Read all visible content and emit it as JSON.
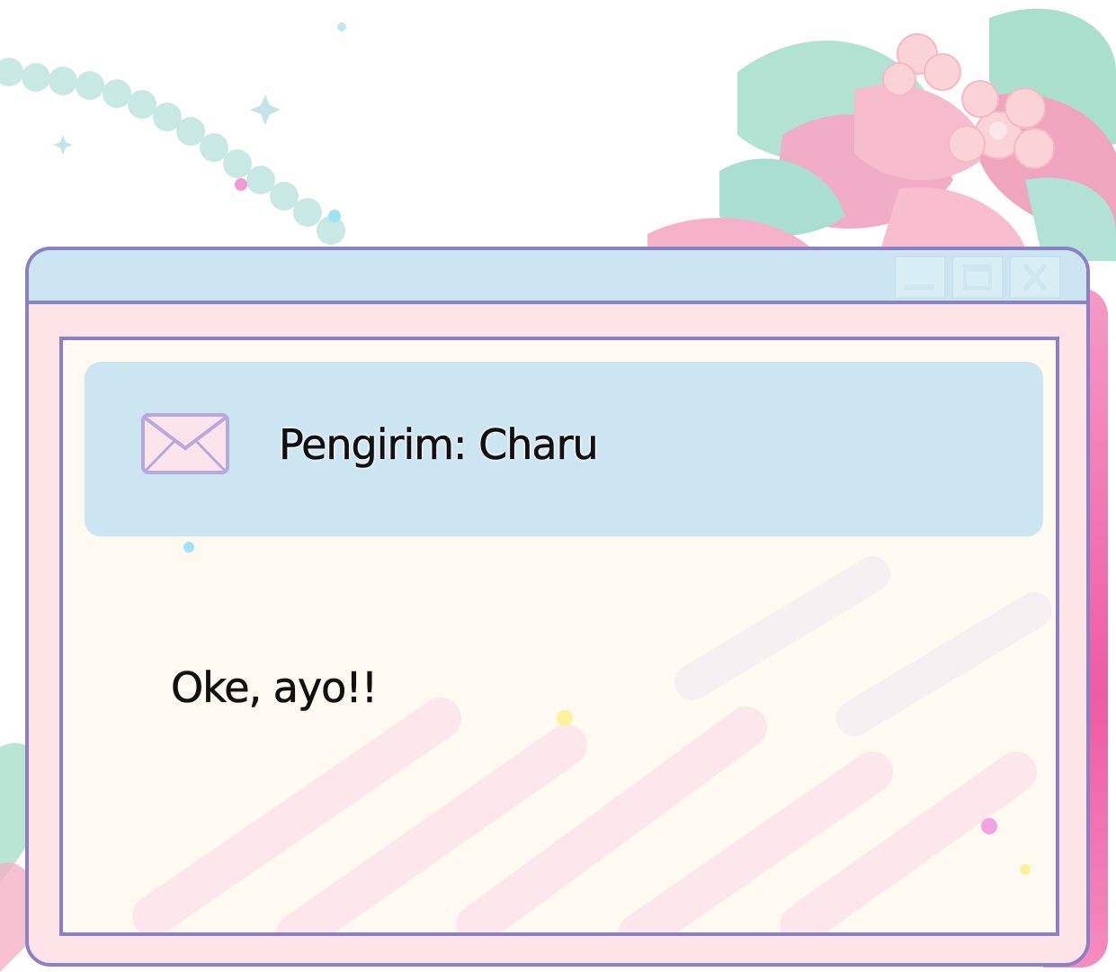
{
  "window": {
    "controls": {
      "minimize": "minimize-icon",
      "maximize": "maximize-icon",
      "close": "close-icon"
    }
  },
  "header": {
    "icon": "mail-icon",
    "sender_label": "Pengirim: Charu"
  },
  "message": {
    "text": "Oke, ayo!!"
  },
  "colors": {
    "frame_border": "#8a80c8",
    "titlebar": "#cbe6f1",
    "window_body": "#fbe3e6",
    "content_bg": "#fefaf2",
    "accent_pink": "#ee5aa5"
  }
}
